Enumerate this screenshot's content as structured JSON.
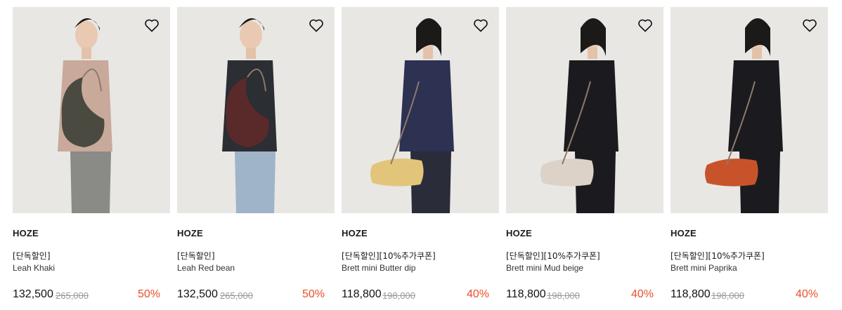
{
  "accent": "#e8502a",
  "products": [
    {
      "brand": "HOZE",
      "promo": "[단독할인]",
      "name": "Leah Khaki",
      "price": "132,500",
      "original_price": "265,000",
      "discount": "50%",
      "bag_color": "#4a4a40",
      "top_color": "#c9a99a",
      "bottom_color": "#8a8a86",
      "wishlist_icon": "heart-outline-icon"
    },
    {
      "brand": "HOZE",
      "promo": "[단독할인]",
      "name": "Leah Red bean",
      "price": "132,500",
      "original_price": "265,000",
      "discount": "50%",
      "bag_color": "#5a2a2a",
      "top_color": "#2b2e33",
      "bottom_color": "#9fb4c8",
      "wishlist_icon": "heart-outline-icon"
    },
    {
      "brand": "HOZE",
      "promo": "[단독할인][10%추가쿠폰]",
      "name": "Brett mini Butter dip",
      "price": "118,800",
      "original_price": "198,000",
      "discount": "40%",
      "bag_color": "#e2c57a",
      "top_color": "#2d3152",
      "bottom_color": "#2a2c3a",
      "wishlist_icon": "heart-outline-icon"
    },
    {
      "brand": "HOZE",
      "promo": "[단독할인][10%추가쿠폰]",
      "name": "Brett mini Mud beige",
      "price": "118,800",
      "original_price": "198,000",
      "discount": "40%",
      "bag_color": "#ddd2c8",
      "top_color": "#1b1b1f",
      "bottom_color": "#1b1b1f",
      "wishlist_icon": "heart-outline-icon"
    },
    {
      "brand": "HOZE",
      "promo": "[단독할인][10%추가쿠폰]",
      "name": "Brett mini Paprika",
      "price": "118,800",
      "original_price": "198,000",
      "discount": "40%",
      "bag_color": "#c8532b",
      "top_color": "#1b1b1f",
      "bottom_color": "#1b1b1f",
      "wishlist_icon": "heart-outline-icon"
    }
  ]
}
